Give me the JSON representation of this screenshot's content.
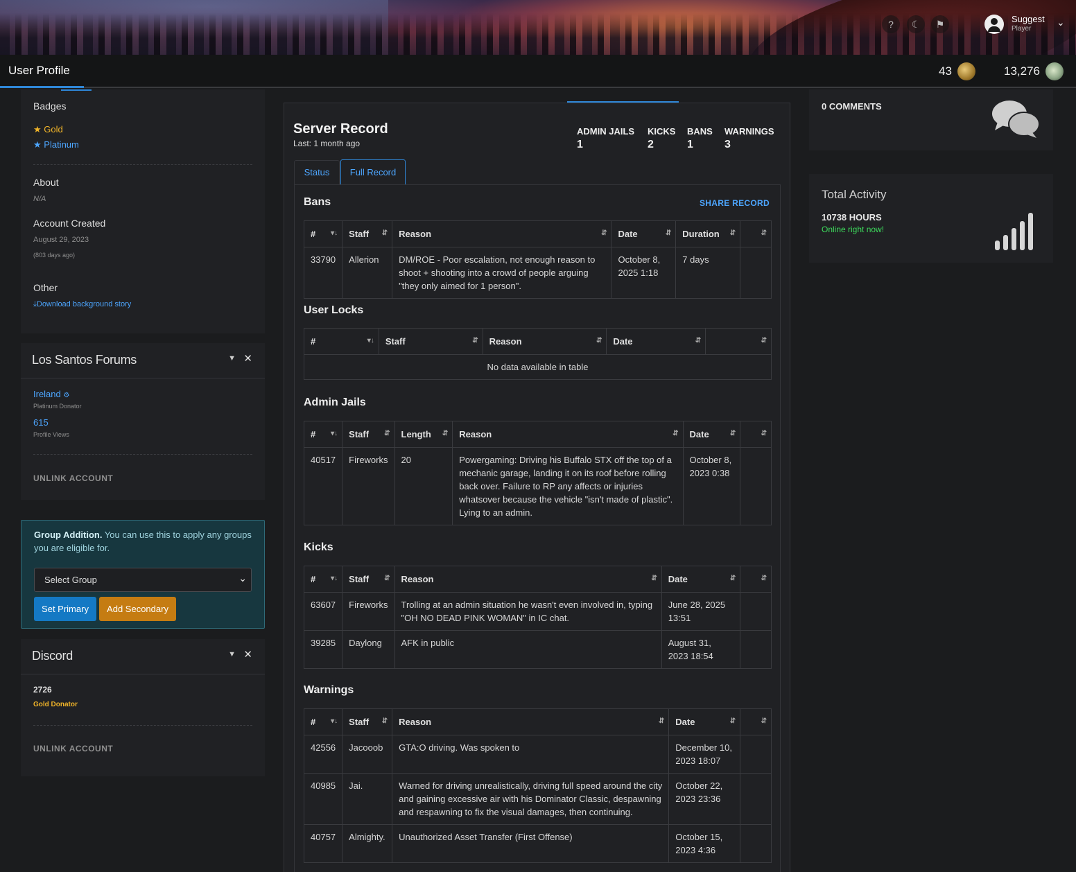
{
  "header": {
    "help_icon": "question-icon",
    "theme_icon": "moon-icon",
    "notif_icon": "bell-icon",
    "user_name": "Suggest",
    "user_role": "Player"
  },
  "topbar": {
    "title": "User Profile",
    "stat1": "43",
    "stat2": "13,276"
  },
  "left": {
    "badges_title": "Badges",
    "badges": [
      {
        "label": "Gold",
        "color": "#f0b429"
      },
      {
        "label": "Platinum",
        "color": "#4da6ff"
      }
    ],
    "about_title": "About",
    "about_value": "N/A",
    "created_title": "Account Created",
    "created_date": "August 29, 2023",
    "created_ago": "(803 days ago)",
    "other_title": "Other",
    "download_link": "Download background story",
    "forums": {
      "title": "Los Santos Forums",
      "name": "Ireland",
      "rank": "Platinum Donator",
      "views": "615",
      "views_label": "Profile Views",
      "unlink": "UNLINK ACCOUNT"
    },
    "group": {
      "bold": "Group Addition.",
      "text": " You can use this to apply any groups you are eligible for.",
      "select": "Select Group",
      "primary": "Set Primary",
      "secondary": "Add Secondary"
    },
    "discord": {
      "title": "Discord",
      "id": "2726",
      "rank": "Gold Donator",
      "unlink": "UNLINK ACCOUNT"
    }
  },
  "record": {
    "title": "Server Record",
    "last": "Last: 1 month ago",
    "counts": [
      {
        "label": "ADMIN JAILS",
        "value": "1"
      },
      {
        "label": "KICKS",
        "value": "2"
      },
      {
        "label": "BANS",
        "value": "1"
      },
      {
        "label": "WARNINGS",
        "value": "3"
      }
    ],
    "tabs": [
      "Status",
      "Full Record"
    ],
    "share": "SHARE RECORD",
    "bans": {
      "title": "Bans",
      "columns": [
        "#",
        "Staff",
        "Reason",
        "Date",
        "Duration",
        ""
      ],
      "rows": [
        [
          "33790",
          "Allerion",
          "DM/ROE - Poor escalation, not enough reason to shoot + shooting into a crowd of people arguing \"they only aimed for 1 person\".",
          "October 8, 2025 1:18",
          "7 days",
          ""
        ]
      ]
    },
    "locks": {
      "title": "User Locks",
      "columns": [
        "#",
        "Staff",
        "Reason",
        "Date",
        ""
      ],
      "empty": "No data available in table"
    },
    "jails": {
      "title": "Admin Jails",
      "columns": [
        "#",
        "Staff",
        "Length",
        "Reason",
        "Date",
        ""
      ],
      "rows": [
        [
          "40517",
          "Fireworks",
          "20",
          "Powergaming: Driving his Buffalo STX off the top of a mechanic garage, landing it on its roof before rolling back over. Failure to RP any affects or injuries whatsover because the vehicle \"isn't made of plastic\". Lying to an admin.",
          "October 8, 2023 0:38",
          ""
        ]
      ]
    },
    "kicks": {
      "title": "Kicks",
      "columns": [
        "#",
        "Staff",
        "Reason",
        "Date",
        ""
      ],
      "rows": [
        [
          "63607",
          "Fireworks",
          "Trolling at an admin situation he wasn't even involved in, typing \"OH NO DEAD PINK WOMAN\" in IC chat.",
          "June 28, 2025 13:51",
          ""
        ],
        [
          "39285",
          "Daylong",
          "AFK in public",
          "August 31, 2023 18:54",
          ""
        ]
      ]
    },
    "warnings": {
      "title": "Warnings",
      "columns": [
        "#",
        "Staff",
        "Reason",
        "Date",
        ""
      ],
      "rows": [
        [
          "42556",
          "Jacooob",
          "GTA:O driving. Was spoken to",
          "December 10, 2023 18:07",
          ""
        ],
        [
          "40985",
          "Jai.",
          "Warned for driving unrealistically, driving full speed around the city and gaining excessive air with his Dominator Classic, despawning and respawning to fix the visual damages, then continuing.",
          "October 22, 2023 23:36",
          ""
        ],
        [
          "40757",
          "Almighty.",
          "Unauthorized Asset Transfer (First Offense)",
          "October 15, 2023 4:36",
          ""
        ]
      ]
    }
  },
  "right": {
    "comments": "0 COMMENTS",
    "activity_title": "Total Activity",
    "hours": "10738 HOURS",
    "online": "Online right now!"
  }
}
